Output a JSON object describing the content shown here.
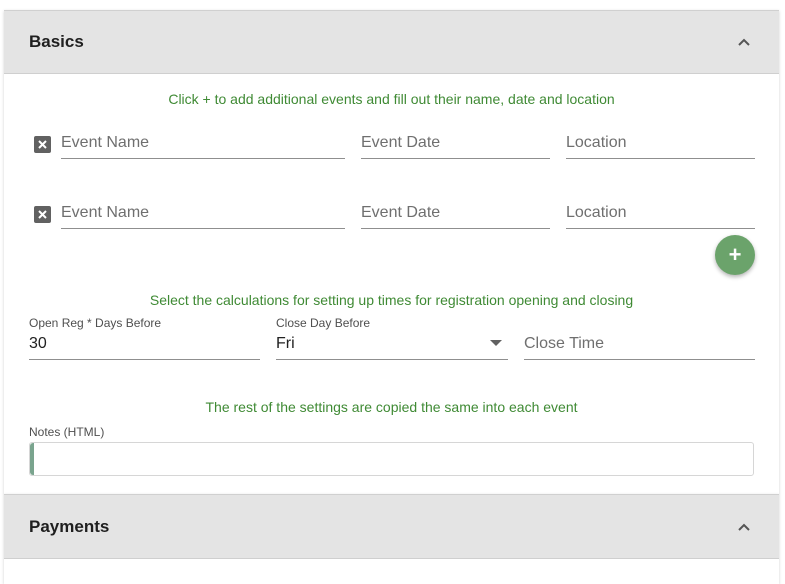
{
  "basics": {
    "title": "Basics",
    "instruction": "Click + to add additional events and fill out their name, date and location",
    "events": [
      {
        "name_placeholder": "Event Name",
        "date_placeholder": "Event Date",
        "location_placeholder": "Location"
      },
      {
        "name_placeholder": "Event Name",
        "date_placeholder": "Event Date",
        "location_placeholder": "Location"
      }
    ],
    "add_button": "+",
    "calc_instruction": "Select the calculations for setting up times for registration opening and closing",
    "open_reg": {
      "label": "Open Reg * Days Before",
      "value": "30"
    },
    "close_day": {
      "label": "Close Day Before",
      "value": "Fri"
    },
    "close_time": {
      "placeholder": "Close Time"
    },
    "copy_note": "The rest of the settings are copied the same into each event",
    "notes": {
      "label": "Notes (HTML)",
      "value": ""
    }
  },
  "payments": {
    "title": "Payments"
  },
  "colors": {
    "header_bg": "#e4e4e4",
    "hint_green": "#3f8a34",
    "fab_green": "#6ba36b"
  },
  "icons": [
    "chevron-up-icon",
    "close-icon",
    "add-icon",
    "dropdown-arrow-icon"
  ]
}
